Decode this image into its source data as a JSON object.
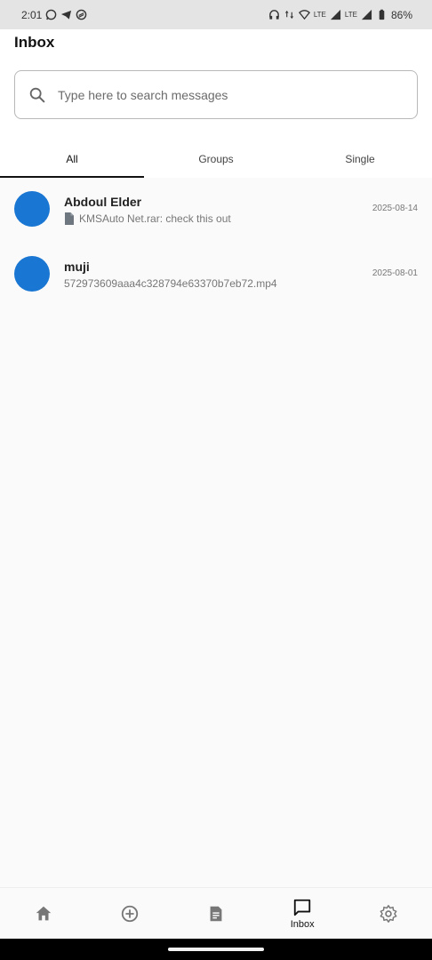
{
  "status_bar": {
    "time": "2:01",
    "lte1": "LTE",
    "lte2": "LTE",
    "battery": "86%",
    "left_icons": [
      "whatsapp-icon",
      "telegram-icon",
      "app-icon"
    ],
    "right_icons": [
      "headphones-icon",
      "data-arrows-icon",
      "wifi-icon",
      "signal-icon",
      "signal-icon",
      "battery-icon"
    ]
  },
  "header": {
    "title": "Inbox",
    "search_placeholder": "Type here to search messages"
  },
  "tabs": [
    {
      "label": "All",
      "active": true
    },
    {
      "label": "Groups",
      "active": false
    },
    {
      "label": "Single",
      "active": false
    }
  ],
  "conversations": [
    {
      "name": "Abdoul Elder",
      "preview": "KMSAuto Net.rar: check this out",
      "preview_icon": "file-icon",
      "date": "2025-08-14",
      "avatar_color": "#1976d2"
    },
    {
      "name": "muji",
      "preview": "572973609aaa4c328794e63370b7eb72.mp4",
      "date": "2025-08-01",
      "avatar_color": "#1976d2"
    }
  ],
  "bottom_nav": {
    "items": [
      {
        "icon": "home-icon"
      },
      {
        "icon": "add-circle-icon"
      },
      {
        "icon": "document-icon"
      },
      {
        "icon": "chat-icon",
        "label": "Inbox",
        "active": true
      },
      {
        "icon": "settings-icon"
      }
    ]
  },
  "colors": {
    "accent": "#1976d2",
    "header_bg": "#ffffff",
    "page_bg": "#fafafa",
    "status_bg": "#e4e4e4"
  }
}
